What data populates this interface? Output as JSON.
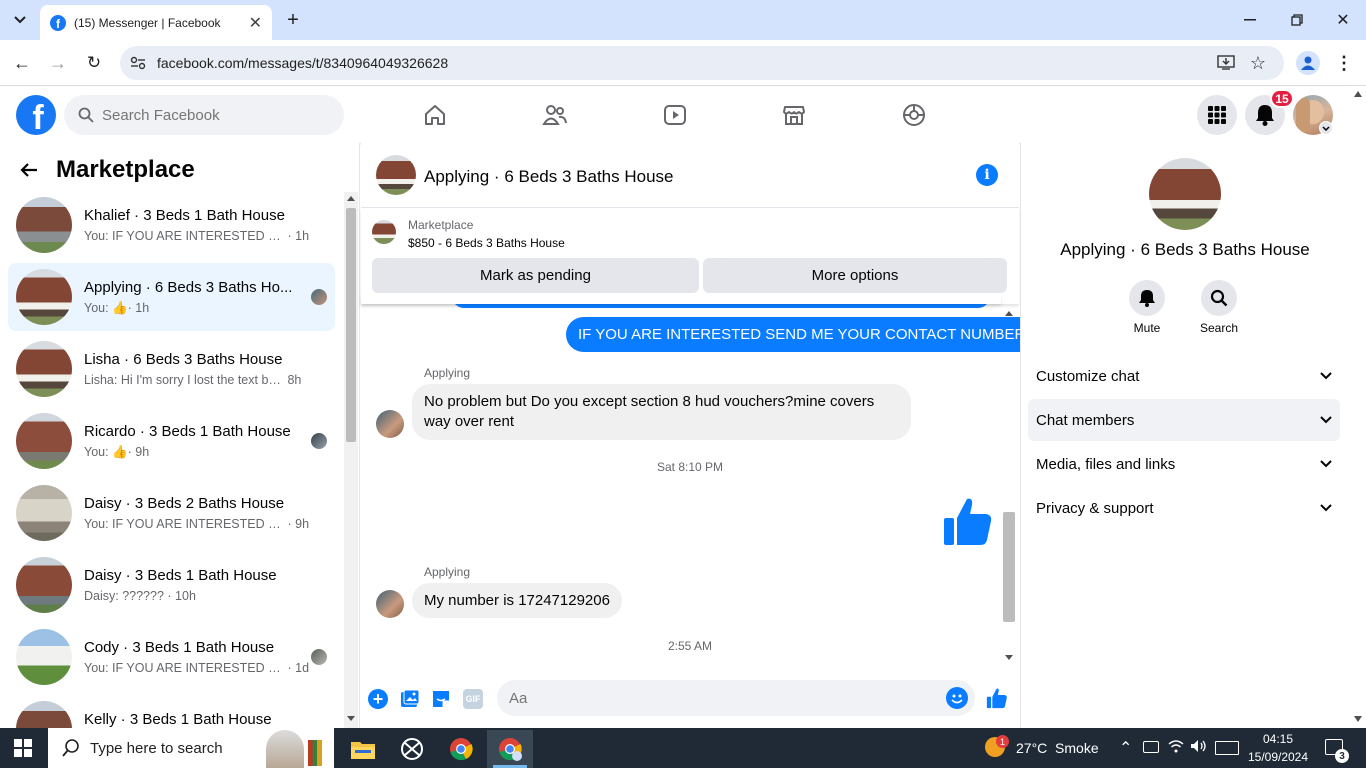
{
  "browser": {
    "tab_title": "(15) Messenger | Facebook",
    "url": "facebook.com/messages/t/8340964049326628"
  },
  "fb": {
    "search_placeholder": "Search Facebook",
    "notification_count": "15"
  },
  "left": {
    "title": "Marketplace",
    "conversations": [
      {
        "name": "Khalief · 3 Beds 1 Bath House",
        "preview": "You: IF YOU ARE INTERESTED SEN...",
        "time": "· 1h"
      },
      {
        "name": "Applying · 6 Beds 3 Baths Ho...",
        "preview": "You:",
        "time": "· 1h"
      },
      {
        "name": "Lisha · 6 Beds 3 Baths House",
        "preview": "Lisha: Hi I'm sorry I lost the text bet...",
        "time": "8h"
      },
      {
        "name": "Ricardo · 3 Beds 1 Bath House",
        "preview": "You:",
        "time": "· 9h"
      },
      {
        "name": "Daisy · 3 Beds 2 Baths House",
        "preview": "You: IF YOU ARE INTERESTED SEN...",
        "time": "· 9h"
      },
      {
        "name": "Daisy · 3 Beds 1 Bath House",
        "preview": "Daisy: ??????",
        "time": "· 10h"
      },
      {
        "name": "Cody · 3 Beds 1 Bath House",
        "preview": "You: IF YOU ARE INTERESTED SE...",
        "time": "· 1d"
      },
      {
        "name": "Kelly · 3 Beds 1 Bath House",
        "preview": "",
        "time": ""
      }
    ]
  },
  "chat": {
    "title": "Applying · 6 Beds 3 Baths House",
    "marketplace_label": "Marketplace",
    "listing": "$850 - 6 Beds 3 Baths House",
    "mark_pending": "Mark as pending",
    "more_options": "More options",
    "messages": {
      "out1": "IF YOU ARE INTERESTED SEND ME YOUR CONTACT NUMBER",
      "sender": "Applying",
      "in1": "No problem but Do you except section 8 hud vouchers?mine covers way over rent",
      "ts1": "Sat 8:10 PM",
      "in2": "My number is 17247129206",
      "ts2": "2:55 AM"
    },
    "input_placeholder": "Aa",
    "gif_label": "GIF"
  },
  "right": {
    "title": "Applying · 6 Beds 3 Baths House",
    "mute": "Mute",
    "search": "Search",
    "sections": [
      "Customize chat",
      "Chat members",
      "Media, files and links",
      "Privacy & support"
    ]
  },
  "taskbar": {
    "search": "Type here to search",
    "weather": "27°C  Smoke",
    "weather_badge": "1",
    "time": "04:15",
    "date": "15/09/2024",
    "notif": "3"
  },
  "colors": {
    "fb_blue": "#1877f2",
    "message_blue": "#0a7cff",
    "active_row": "#ebf5ff"
  }
}
